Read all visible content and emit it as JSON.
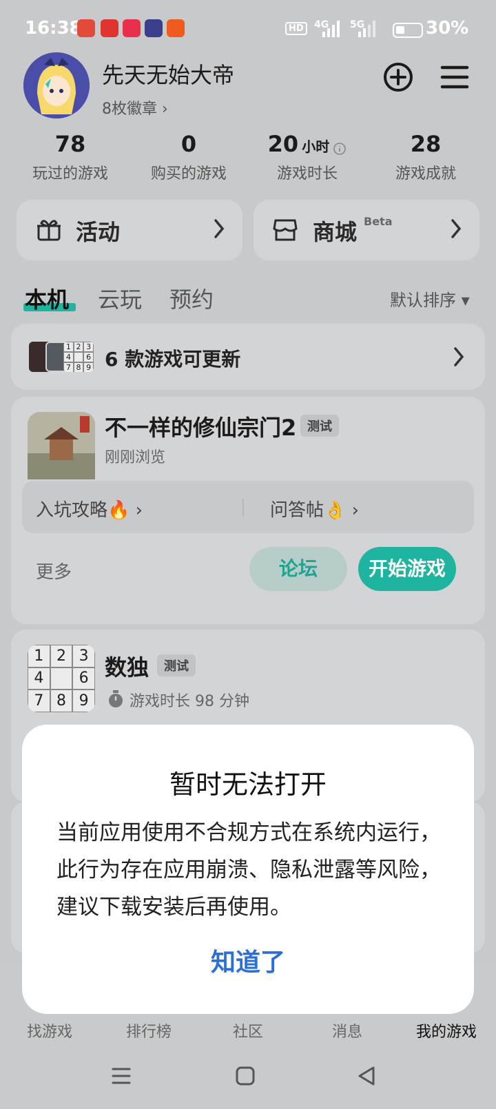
{
  "status_bar": {
    "time": "16:38",
    "network_1": "4G",
    "network_2": "5G",
    "hd_label": "HD",
    "battery": "30%"
  },
  "profile": {
    "username": "先天无始大帝",
    "badges": "8枚徽章 ›"
  },
  "stats": [
    {
      "value": "78",
      "unit": "",
      "label": "玩过的游戏"
    },
    {
      "value": "0",
      "unit": "",
      "label": "购买的游戏"
    },
    {
      "value": "20",
      "unit": "小时",
      "label": "游戏时长"
    },
    {
      "value": "28",
      "unit": "",
      "label": "游戏成就"
    }
  ],
  "quick_cards": {
    "activity": "活动",
    "store": "商城",
    "store_badge": "Beta"
  },
  "tabs": {
    "local": "本机",
    "cloud": "云玩",
    "reserve": "预约",
    "sort": "默认排序 ▾"
  },
  "update_banner": {
    "text": "6 款游戏可更新",
    "sudoku_cells": [
      "1",
      "2",
      "3",
      "4",
      "",
      "6",
      "7",
      "8",
      "9"
    ]
  },
  "game1": {
    "title": "不一样的修仙宗门2",
    "tag": "测试",
    "subtitle": "刚刚浏览",
    "link1": "入坑攻略🔥 ›",
    "link2": "问答帖👌 ›",
    "more": "更多",
    "forum_button": "论坛",
    "play_button": "开始游戏"
  },
  "game2": {
    "title": "数独",
    "tag": "测试",
    "playtime": "游戏时长 98 分钟",
    "sudoku_cells": [
      "1",
      "2",
      "3",
      "4",
      "",
      "6",
      "7",
      "8",
      "9"
    ]
  },
  "bottom_nav": [
    "找游戏",
    "排行榜",
    "社区",
    "消息",
    "我的游戏"
  ],
  "dialog": {
    "title": "暂时无法打开",
    "body": "当前应用使用不合规方式在系统内运行，此行为存在应用崩溃、隐私泄露等风险，建议下载安装后再使用。",
    "ok": "知道了"
  },
  "colors": {
    "accent": "#1fb4a0",
    "dialog_button": "#2c6fd6"
  }
}
